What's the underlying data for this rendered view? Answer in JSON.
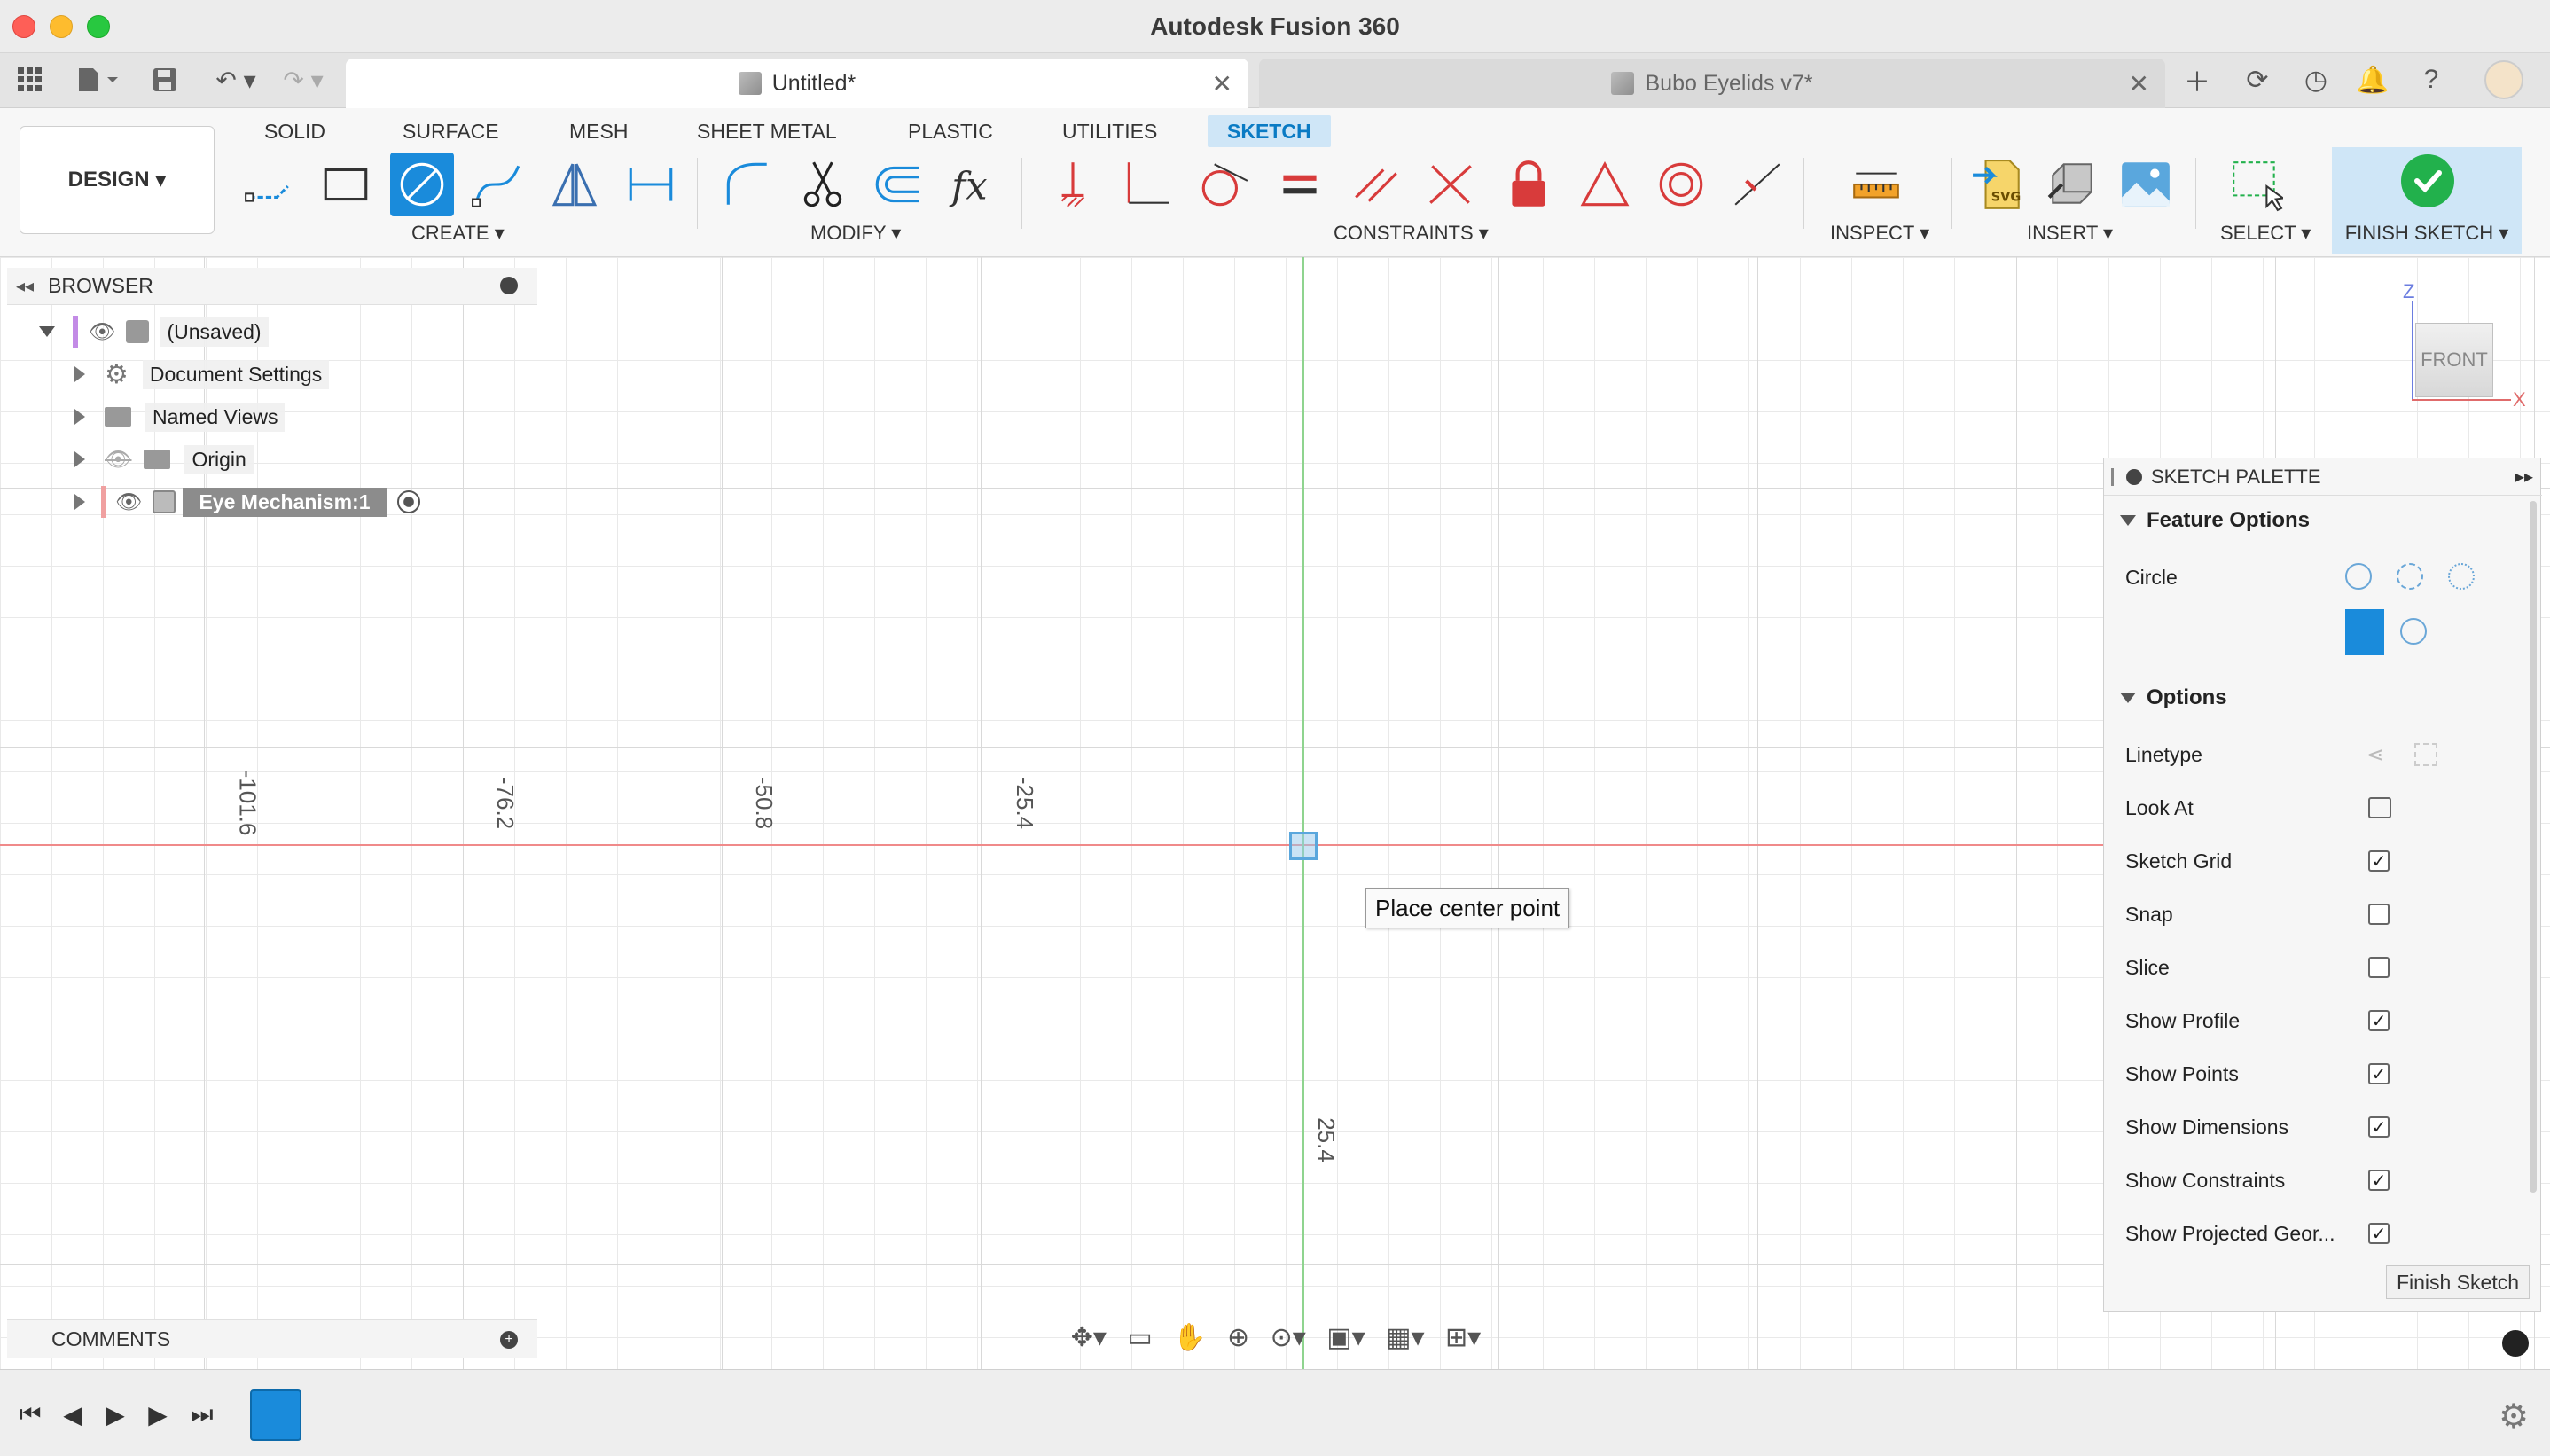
{
  "window": {
    "title": "Autodesk Fusion 360"
  },
  "tabs": [
    {
      "label": "Untitled*",
      "active": true
    },
    {
      "label": "Bubo Eyelids v7*",
      "active": false
    }
  ],
  "ribbon": {
    "workspace": "DESIGN",
    "workspace_tabs": [
      "SOLID",
      "SURFACE",
      "MESH",
      "SHEET METAL",
      "PLASTIC",
      "UTILITIES",
      "SKETCH"
    ],
    "active_tab": "SKETCH",
    "groups": {
      "create": "CREATE",
      "modify": "MODIFY",
      "constraints": "CONSTRAINTS",
      "inspect": "INSPECT",
      "insert": "INSERT",
      "select": "SELECT",
      "finish": "FINISH SKETCH"
    },
    "accent_color": "#1a8bdb",
    "finish_color": "#22b14c",
    "constraint_color": "#d83b3b"
  },
  "browser": {
    "title": "BROWSER",
    "root": "(Unsaved)",
    "items": [
      {
        "label": "Document Settings",
        "icon": "gear-icon"
      },
      {
        "label": "Named Views",
        "icon": "folder-icon"
      },
      {
        "label": "Origin",
        "icon": "folder-icon",
        "hidden": true
      },
      {
        "label": "Eye Mechanism:1",
        "icon": "component-icon",
        "active": true
      }
    ]
  },
  "canvas": {
    "axis_labels_x": [
      "-101.6",
      "-76.2",
      "-50.8",
      "-25.4"
    ],
    "axis_labels_y": [
      "25.4"
    ],
    "tooltip": "Place center point",
    "viewcube_face": "FRONT",
    "axis_z": "Z",
    "axis_x": "X"
  },
  "palette": {
    "title": "SKETCH PALETTE",
    "feature_options": "Feature Options",
    "circle_label": "Circle",
    "options_title": "Options",
    "options": [
      {
        "label": "Linetype",
        "type": "icons"
      },
      {
        "label": "Look At",
        "type": "icon"
      },
      {
        "label": "Sketch Grid",
        "checked": true
      },
      {
        "label": "Snap",
        "checked": false
      },
      {
        "label": "Slice",
        "checked": false
      },
      {
        "label": "Show Profile",
        "checked": true
      },
      {
        "label": "Show Points",
        "checked": true
      },
      {
        "label": "Show Dimensions",
        "checked": true
      },
      {
        "label": "Show Constraints",
        "checked": true
      },
      {
        "label": "Show Projected Geor...",
        "checked": true
      }
    ],
    "finish_button": "Finish Sketch"
  },
  "comments": {
    "title": "COMMENTS"
  }
}
